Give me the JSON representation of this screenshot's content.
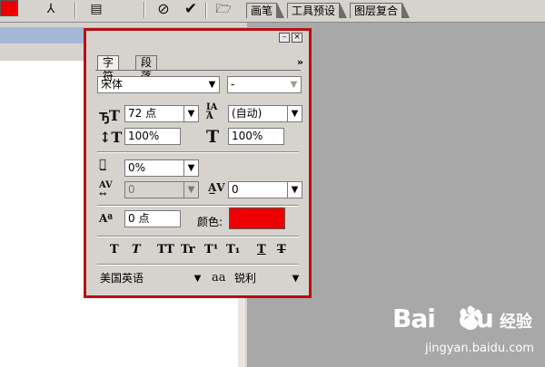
{
  "optionsbar": {
    "wells": [
      "画笔",
      "工具预设",
      "图层复合"
    ],
    "color": "#ee0000"
  },
  "panel": {
    "tabs": [
      "字符",
      "段落"
    ],
    "font_family": "宋体",
    "font_style": "-",
    "font_size": "72 点",
    "leading": "(自动)",
    "vertical_scale": "100%",
    "horizontal_scale": "100%",
    "tracking": "0%",
    "kerning": "0",
    "char_spacing": "0",
    "baseline_shift": "0 点",
    "color_label": "颜色:",
    "text_color": "#ee0000",
    "style_buttons": [
      "T",
      "T",
      "TT",
      "Tr",
      "T¹",
      "T₁",
      "T",
      "T"
    ],
    "language": "美国英语",
    "aa_icon": "aa",
    "antialias": "锐利"
  },
  "watermark": {
    "brand": "Bai",
    "brand_suffix": "du",
    "name": "经验",
    "url": "jingyan.baidu.com"
  }
}
